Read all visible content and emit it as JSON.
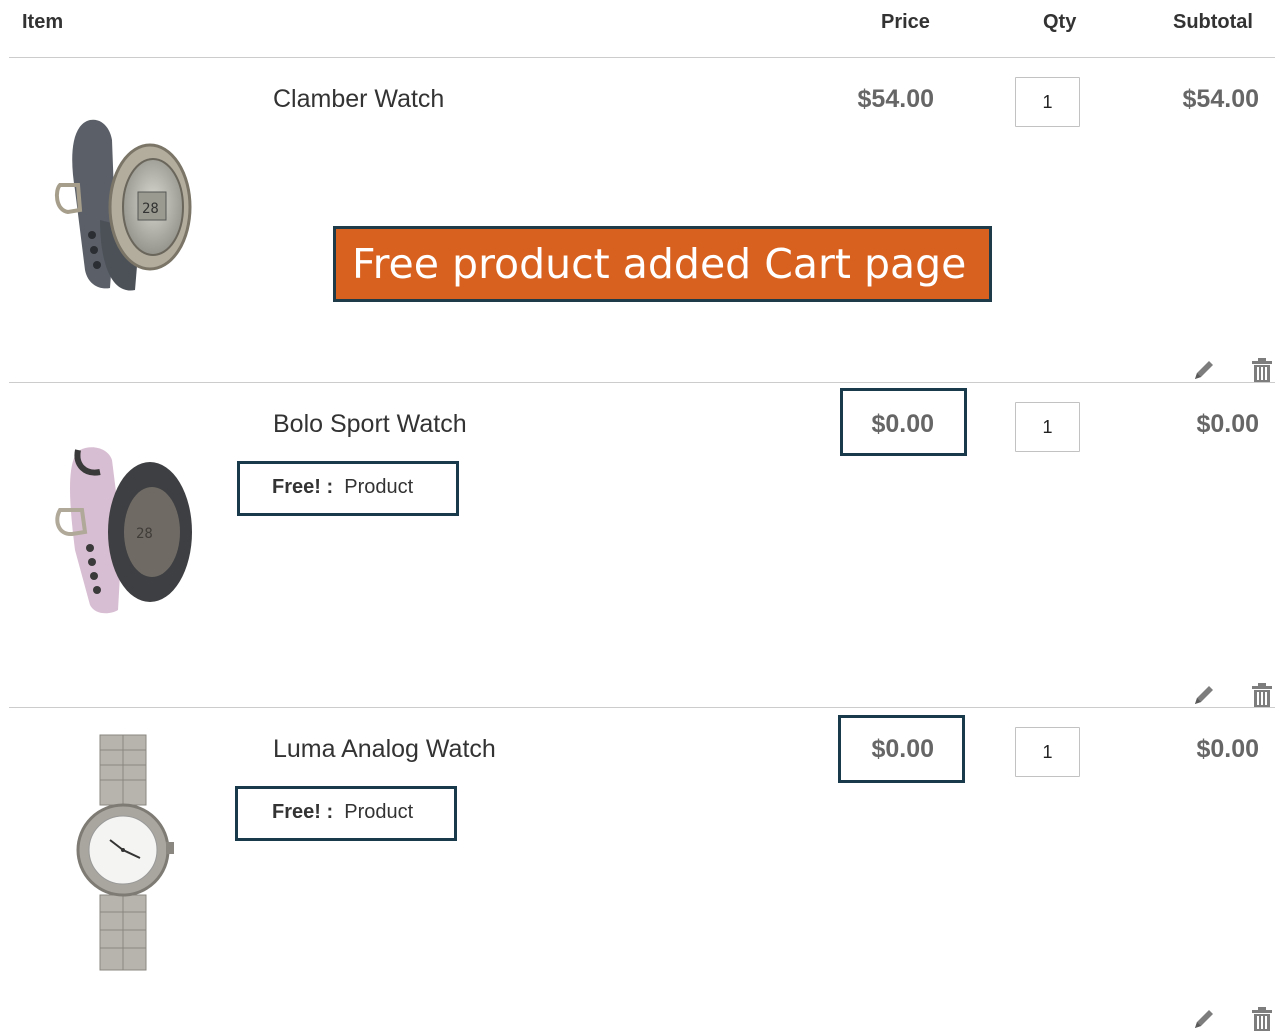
{
  "table": {
    "headers": {
      "item": "Item",
      "price": "Price",
      "qty": "Qty",
      "subtotal": "Subtotal"
    }
  },
  "items": [
    {
      "name": "Clamber Watch",
      "price": "$54.00",
      "qty": "1",
      "subtotal": "$54.00",
      "free_label": "",
      "free_value": "",
      "icons": [
        "edit-icon",
        "trash-icon"
      ]
    },
    {
      "name": "Bolo Sport Watch",
      "price": "$0.00",
      "qty": "1",
      "subtotal": "$0.00",
      "free_label": "Free! :",
      "free_value": "Product",
      "icons": [
        "edit-icon",
        "trash-icon"
      ]
    },
    {
      "name": "Luma Analog Watch",
      "price": "$0.00",
      "qty": "1",
      "subtotal": "$0.00",
      "free_label": "Free! :",
      "free_value": "Product",
      "icons": [
        "edit-icon",
        "trash-icon"
      ]
    }
  ],
  "annotation": {
    "banner_text": "Free product added Cart page",
    "banner_color": "#d9611f",
    "highlight_color": "#183a4a"
  }
}
